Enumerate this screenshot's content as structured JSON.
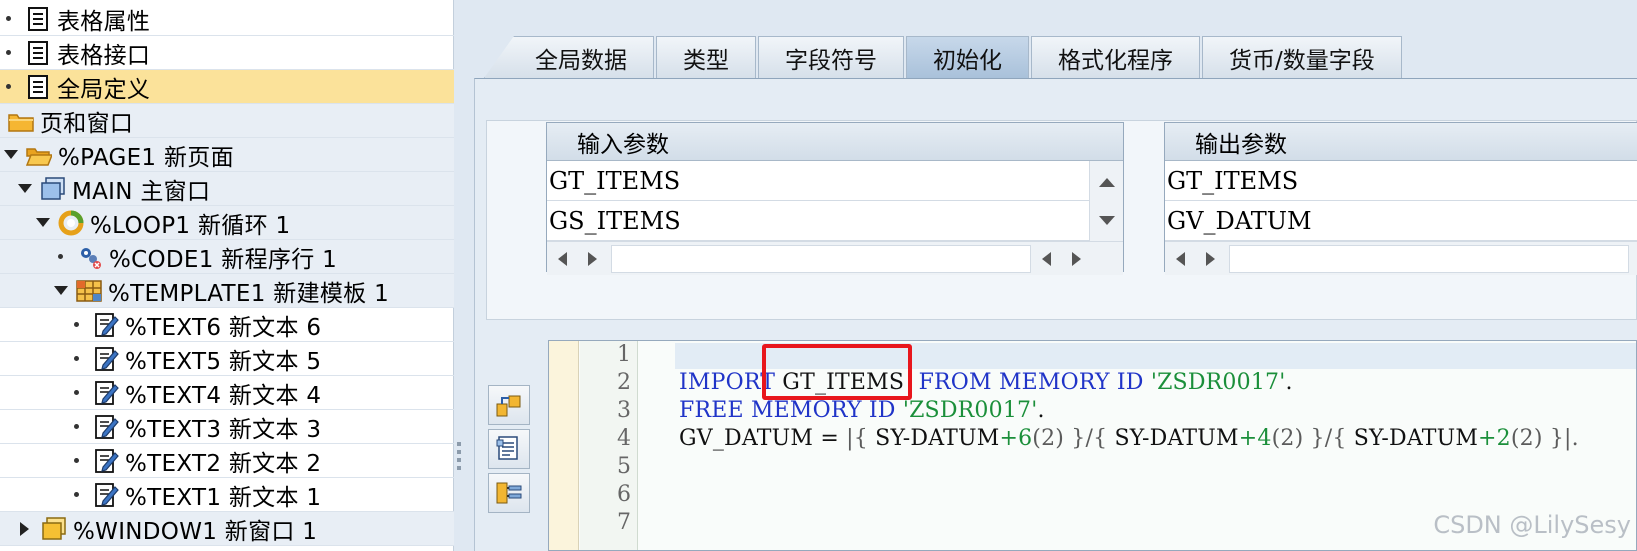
{
  "tree": {
    "items": [
      {
        "label": "表格属性",
        "icon": "document-icon"
      },
      {
        "label": "表格接口",
        "icon": "document-icon"
      },
      {
        "label": "全局定义",
        "icon": "document-icon"
      },
      {
        "label": "页和窗口",
        "icon": "folder-icon"
      },
      {
        "label": "%PAGE1 新页面",
        "icon": "folder-open-icon"
      },
      {
        "label": "MAIN 主窗口",
        "icon": "window-icon"
      },
      {
        "label": "%LOOP1 新循环 1",
        "icon": "loop-icon"
      },
      {
        "label": "%CODE1 新程序行 1",
        "icon": "code-gear-icon"
      },
      {
        "label": "%TEMPLATE1 新建模板 1",
        "icon": "template-grid-icon"
      },
      {
        "label": "%TEXT6 新文本 6",
        "icon": "text-edit-icon"
      },
      {
        "label": "%TEXT5 新文本 5",
        "icon": "text-edit-icon"
      },
      {
        "label": "%TEXT4 新文本 4",
        "icon": "text-edit-icon"
      },
      {
        "label": "%TEXT3 新文本 3",
        "icon": "text-edit-icon"
      },
      {
        "label": "%TEXT2 新文本 2",
        "icon": "text-edit-icon"
      },
      {
        "label": "%TEXT1 新文本 1",
        "icon": "text-edit-icon"
      },
      {
        "label": "%WINDOW1 新窗口 1",
        "icon": "window-yellow-icon"
      }
    ],
    "selected": "全局定义"
  },
  "tabs": [
    {
      "label": "全局数据"
    },
    {
      "label": "类型"
    },
    {
      "label": "字段符号"
    },
    {
      "label": "初始化",
      "active": true
    },
    {
      "label": "格式化程序"
    },
    {
      "label": "货币/数量字段"
    }
  ],
  "input_params": {
    "header": "输入参数",
    "rows": [
      "GT_ITEMS",
      "GS_ITEMS"
    ]
  },
  "output_params": {
    "header": "输出参数",
    "rows": [
      "GT_ITEMS",
      "GV_DATUM"
    ]
  },
  "code": {
    "line_numbers": [
      "1",
      "2",
      "3",
      "4",
      "5",
      "6",
      "7"
    ],
    "line2": {
      "kw1": "IMPORT",
      "var": " GT_ITEMS ",
      "kw2": " FROM MEMORY ID ",
      "str": "'ZSDR0017'",
      "end": "."
    },
    "line3": {
      "kw1": "FREE MEMORY ID ",
      "str": "'ZSDR0017'",
      "end": "."
    },
    "line4": {
      "a": "GV_DATUM = ",
      "b": "|{ ",
      "c": "SY-DATUM",
      "d": "+6",
      "e": "(2)",
      "f": " }/{ ",
      "g": "SY-DATUM",
      "h": "+4",
      "i": "(2)",
      "j": " }/{ ",
      "k": "SY-DATUM",
      "l": "+2",
      "m": "(2)",
      "n": " }|."
    }
  },
  "colors": {
    "selected_row": "#fbe29a",
    "keyword": "#2034c8",
    "string": "#1b8f3a",
    "highlight_box": "#e8161c"
  },
  "watermark": "CSDN @LilySesy"
}
